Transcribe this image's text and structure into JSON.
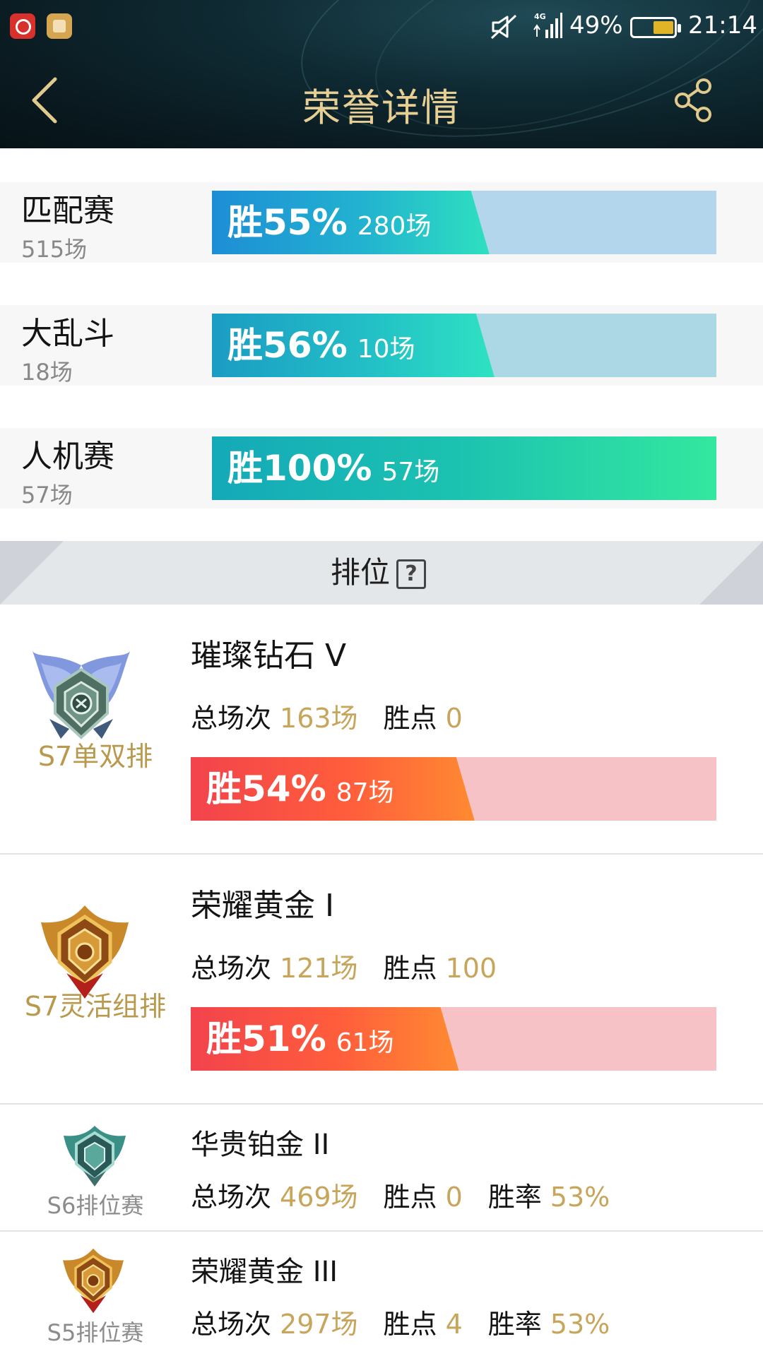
{
  "status_bar": {
    "battery": "49%",
    "time": "21:14"
  },
  "header": {
    "title": "荣誉详情"
  },
  "modes": [
    {
      "name": "匹配赛",
      "total": "515场",
      "win_label": "胜55%",
      "games": "280场",
      "win_fraction": 0.55
    },
    {
      "name": "大乱斗",
      "total": "18场",
      "win_label": "胜56%",
      "games": "10场",
      "win_fraction": 0.56
    },
    {
      "name": "人机赛",
      "total": "57场",
      "win_label": "胜100%",
      "games": "57场",
      "win_fraction": 1.0
    }
  ],
  "ranked": {
    "title": "排位",
    "help": "?"
  },
  "seasons": [
    {
      "season": "S7单双排",
      "rank": "璀璨钻石 V",
      "total_label": "总场次",
      "total": "163场",
      "points_label": "胜点",
      "points": "0",
      "win_label": "胜54%",
      "games": "87场",
      "win_fraction": 0.54,
      "badge": "diamond-badge"
    },
    {
      "season": "S7灵活组排",
      "rank": "荣耀黄金 I",
      "total_label": "总场次",
      "total": "121场",
      "points_label": "胜点",
      "points": "100",
      "win_label": "胜51%",
      "games": "61场",
      "win_fraction": 0.51,
      "badge": "gold-badge"
    },
    {
      "season": "S6排位赛",
      "rank": "华贵铂金 II",
      "total_label": "总场次",
      "total": "469场",
      "points_label": "胜点",
      "points": "0",
      "rate_label": "胜率",
      "rate": "53%",
      "badge": "platinum-badge"
    },
    {
      "season": "S5排位赛",
      "rank": "荣耀黄金 III",
      "total_label": "总场次",
      "total": "297场",
      "points_label": "胜点",
      "points": "4",
      "rate_label": "胜率",
      "rate": "53%",
      "badge": "gold-badge"
    }
  ],
  "colors": {
    "accent_gold": "#c7a55a",
    "title_gold": "#e7cf94",
    "blue_bar": "#2a95d8",
    "teal_bar": "#2edbc0",
    "red_bar": "#f2434c",
    "orange_bar": "#ff8a32",
    "pink_track": "#f6c2c6"
  }
}
